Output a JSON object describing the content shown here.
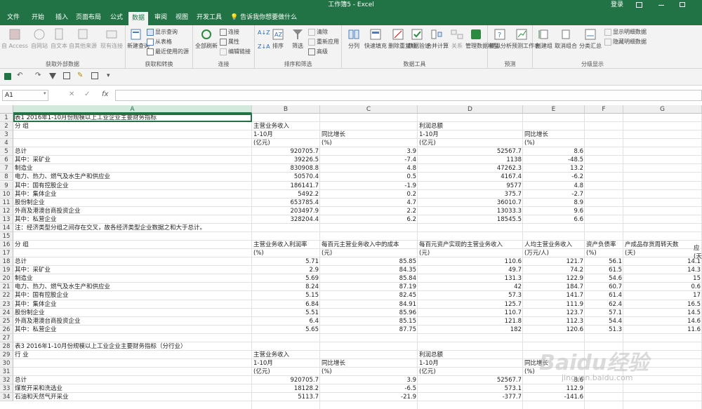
{
  "app": {
    "title": "工作簿5 - Excel",
    "login": "登录"
  },
  "tabs": [
    "文件",
    "开始",
    "插入",
    "页面布局",
    "公式",
    "数据",
    "审阅",
    "视图",
    "开发工具"
  ],
  "active_tab": "数据",
  "tellme": "告诉我你想要做什么",
  "ribbon": {
    "get_external": {
      "label": "获取外部数据",
      "buttons": [
        "自 Access",
        "自网站",
        "自文本",
        "自其他来源",
        "现有连接"
      ]
    },
    "get_transform": {
      "label": "获取和转换",
      "big": "新建查询",
      "small": [
        "显示查询",
        "从表格",
        "最近使用的源"
      ]
    },
    "connections": {
      "label": "连接",
      "big": "全部刷新",
      "small": [
        "连接",
        "属性",
        "编辑链接"
      ]
    },
    "sort_filter": {
      "label": "排序和筛选",
      "sort": "排序",
      "filter": "筛选",
      "small": [
        "清除",
        "重新应用",
        "高级"
      ]
    },
    "data_tools": {
      "label": "数据工具",
      "buttons": [
        "分列",
        "快速填充",
        "删除重复项",
        "数据验证",
        "合并计算",
        "关系",
        "管理数据模型"
      ]
    },
    "forecast": {
      "label": "预测",
      "buttons": [
        "模拟分析",
        "预测工作表"
      ]
    },
    "outline": {
      "label": "分级显示",
      "buttons": [
        "创建组",
        "取消组合",
        "分类汇总"
      ],
      "small": [
        "显示明细数据",
        "隐藏明细数据"
      ]
    }
  },
  "name_box": "A1",
  "formula_icons": {
    "cancel": "✕",
    "enter": "✓",
    "fx": "fx"
  },
  "columns": [
    "A",
    "B",
    "C",
    "D",
    "E",
    "F",
    "G"
  ],
  "rows": [
    {
      "n": "1",
      "cells": [
        "表1  2016年1-10月份规模以上工业企业主要财务指标",
        "",
        "",
        "",
        "",
        "",
        ""
      ]
    },
    {
      "n": "2",
      "cells": [
        "分 组",
        "主营业务收入",
        "",
        "利润总额",
        "",
        "",
        ""
      ]
    },
    {
      "n": "3",
      "cells": [
        "",
        "1-10月",
        "同比增长",
        "1-10月",
        "同比增长",
        "",
        ""
      ]
    },
    {
      "n": "4",
      "cells": [
        "",
        "(亿元)",
        "(%)",
        "(亿元)",
        "(%)",
        "",
        ""
      ]
    },
    {
      "n": "5",
      "cells": [
        "总计",
        "920705.7",
        "3.9",
        "52567.7",
        "8.6",
        "",
        ""
      ]
    },
    {
      "n": "6",
      "cells": [
        "其中：采矿业",
        "39226.5",
        "-7.4",
        "1138",
        "-48.5",
        "",
        ""
      ]
    },
    {
      "n": "7",
      "cells": [
        "    制造业",
        "830908.8",
        "4.8",
        "47262.3",
        "13.2",
        "",
        ""
      ]
    },
    {
      "n": "8",
      "cells": [
        "    电力、热力、燃气及水生产和供应业",
        "50570.4",
        "0.5",
        "4167.4",
        "-6.2",
        "",
        ""
      ]
    },
    {
      "n": "9",
      "cells": [
        "其中：国有控股企业",
        "186141.7",
        "-1.9",
        "9577",
        "4.8",
        "",
        ""
      ]
    },
    {
      "n": "10",
      "cells": [
        "其中：集体企业",
        "5492.2",
        "0.2",
        "375.7",
        "-2.7",
        "",
        ""
      ]
    },
    {
      "n": "11",
      "cells": [
        "    股份制企业",
        "653785.4",
        "4.7",
        "36010.7",
        "8.9",
        "",
        ""
      ]
    },
    {
      "n": "12",
      "cells": [
        "    外商及港澳台商投资企业",
        "203497.9",
        "2.2",
        "13033.3",
        "9.6",
        "",
        ""
      ]
    },
    {
      "n": "13",
      "cells": [
        "其中：私营企业",
        "328204.4",
        "6.2",
        "18545.5",
        "6.6",
        "",
        ""
      ]
    },
    {
      "n": "14",
      "cells": [
        "注：经济类型分组之间存在交叉，故各经济类型企业数据之和大于总计。",
        "",
        "",
        "",
        "",
        "",
        ""
      ]
    },
    {
      "n": "15",
      "cells": [
        "",
        "",
        "",
        "",
        "",
        "",
        ""
      ]
    },
    {
      "n": "16",
      "cells": [
        "分 组",
        "主营业务收入利润率",
        "每百元主营业务收入中的成本",
        "每百元资产实现的主营业务收入",
        "人均主营业务收入",
        "资产负债率",
        "产成品存货周转天数"
      ]
    },
    {
      "n": "17",
      "cells": [
        "",
        "(%)",
        "(元)",
        "(元)",
        "(万元/人)",
        "(%)",
        "(天)"
      ]
    },
    {
      "n": "18",
      "cells": [
        "总计",
        "5.71",
        "85.85",
        "110.6",
        "121.7",
        "56.1",
        "14.1"
      ]
    },
    {
      "n": "19",
      "cells": [
        "其中：采矿业",
        "2.9",
        "84.35",
        "49.7",
        "74.2",
        "61.5",
        "14.3"
      ]
    },
    {
      "n": "20",
      "cells": [
        "    制造业",
        "5.69",
        "85.84",
        "131.3",
        "122.9",
        "54.6",
        "15"
      ]
    },
    {
      "n": "21",
      "cells": [
        "    电力、热力、燃气及水生产和供应业",
        "8.24",
        "87.19",
        "42",
        "184.7",
        "60.7",
        "0.6"
      ]
    },
    {
      "n": "22",
      "cells": [
        "其中：国有控股企业",
        "5.15",
        "82.45",
        "57.3",
        "141.7",
        "61.4",
        "17"
      ]
    },
    {
      "n": "23",
      "cells": [
        "其中：集体企业",
        "6.84",
        "84.91",
        "125.7",
        "111.9",
        "62.4",
        "16.5"
      ]
    },
    {
      "n": "24",
      "cells": [
        "    股份制企业",
        "5.51",
        "85.96",
        "110.7",
        "123.7",
        "57.1",
        "14.5"
      ]
    },
    {
      "n": "25",
      "cells": [
        "    外商及港澳台商投资企业",
        "6.4",
        "85.15",
        "121.8",
        "112.3",
        "54.4",
        "14.6"
      ]
    },
    {
      "n": "26",
      "cells": [
        "其中：私营企业",
        "5.65",
        "87.75",
        "182",
        "120.6",
        "51.3",
        "11.6"
      ]
    },
    {
      "n": "27",
      "cells": [
        "",
        "",
        "",
        "",
        "",
        "",
        ""
      ]
    },
    {
      "n": "28",
      "cells": [
        "    表3  2016年1-10月份规模以上工业企业主要财务指标（分行业）",
        "",
        "",
        "",
        "",
        "",
        ""
      ]
    },
    {
      "n": "29",
      "cells": [
        "行 业",
        "主营业务收入",
        "",
        "利润总额",
        "",
        "",
        ""
      ]
    },
    {
      "n": "30",
      "cells": [
        "",
        "1-10月",
        "同比增长",
        "1-10月",
        "同比增长",
        "",
        ""
      ]
    },
    {
      "n": "31",
      "cells": [
        "",
        "(亿元)",
        "(%)",
        "(亿元)",
        "(%)",
        "",
        ""
      ]
    },
    {
      "n": "32",
      "cells": [
        "总计",
        "920705.7",
        "3.9",
        "52567.7",
        "8.6",
        "",
        ""
      ]
    },
    {
      "n": "33",
      "cells": [
        "  煤炭开采和洗选业",
        "18128.2",
        "-6.5",
        "573.1",
        "112.9",
        "",
        ""
      ]
    },
    {
      "n": "34",
      "cells": [
        "  石油和天然气开采业",
        "5113.7",
        "-21.9",
        "-377.7",
        "-141.6",
        "",
        ""
      ]
    }
  ],
  "overflow_col_text": {
    "row16": "应",
    "row17": "(天"
  },
  "watermark": {
    "text": "Baidu经验",
    "url": "jingyan.baidu.com"
  },
  "colors": {
    "accent": "#217346"
  }
}
